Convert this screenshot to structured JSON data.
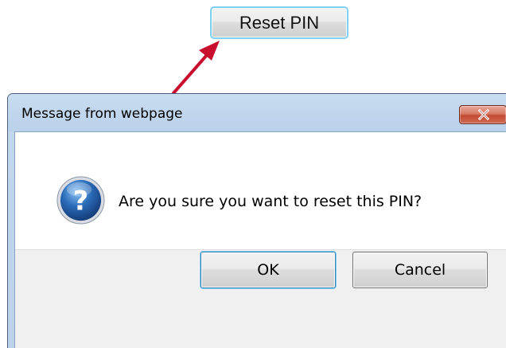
{
  "top_button": {
    "label": "Reset PIN"
  },
  "dialog": {
    "title": "Message from webpage",
    "message": "Are you sure you want to reset this PIN?",
    "ok_label": "OK",
    "cancel_label": "Cancel"
  },
  "icons": {
    "message": "question-icon",
    "close": "close-icon",
    "pointer": "arrow-annotation"
  },
  "colors": {
    "arrow": "#c8102e",
    "close_button": "#c24a33",
    "question_icon": "#2b6cb8",
    "focus_ring": "#7fd1f5"
  }
}
